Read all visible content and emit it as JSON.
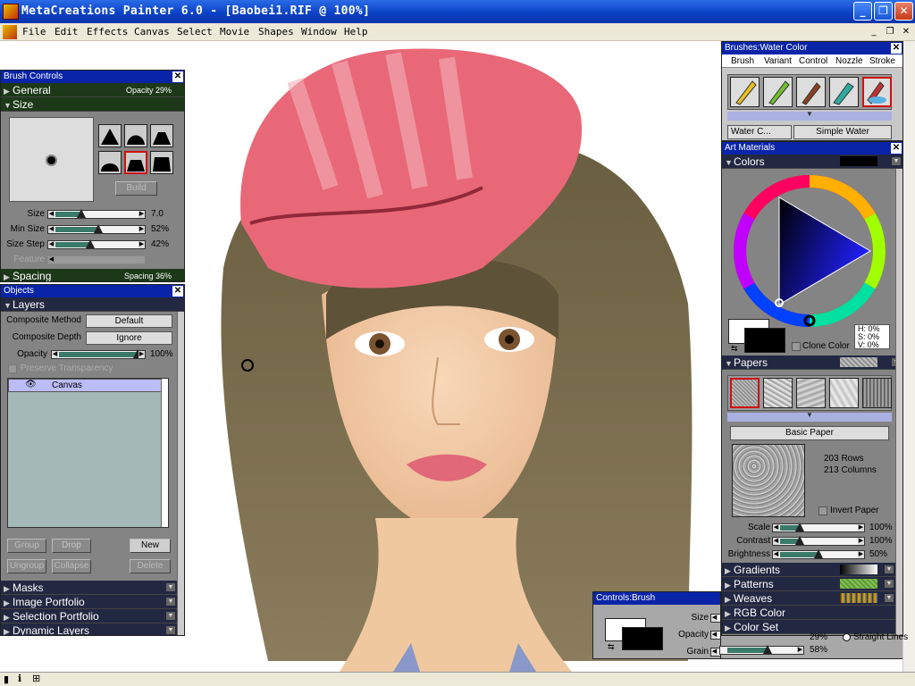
{
  "window": {
    "title": "MetaCreations Painter 6.0 - [Baobei1.RIF @ 100%]"
  },
  "menu": [
    "File",
    "Edit",
    "Effects",
    "Canvas",
    "Select",
    "Movie",
    "Shapes",
    "Window",
    "Help"
  ],
  "brush_controls": {
    "title": "Brush Controls",
    "general": {
      "label": "General",
      "info": "Opacity 29%"
    },
    "size": {
      "label": "Size",
      "build": "Build",
      "sliders": [
        {
          "label": "Size",
          "value": "7.0",
          "level": 0.31
        },
        {
          "label": "Min Size",
          "value": "52%",
          "level": 0.52
        },
        {
          "label": "Size Step",
          "value": "42%",
          "level": 0.42
        },
        {
          "label": "Feature",
          "value": "",
          "level": 0
        }
      ]
    },
    "spacing": {
      "label": "Spacing",
      "info": "Spacing 36%"
    }
  },
  "objects": {
    "title": "Objects",
    "layers": "Layers",
    "composite_method": {
      "label": "Composite Method",
      "value": "Default"
    },
    "composite_depth": {
      "label": "Composite Depth",
      "value": "Ignore"
    },
    "opacity": {
      "label": "Opacity",
      "value": "100%",
      "level": 1.0
    },
    "preserve": "Preserve Transparency",
    "layer_item": "Canvas",
    "buttons": {
      "group": "Group",
      "drop": "Drop",
      "new": "New",
      "ungroup": "Ungroup",
      "collapse": "Collapse",
      "delete": "Delete"
    },
    "sections": [
      "Masks",
      "Image Portfolio",
      "Selection Portfolio",
      "Dynamic Layers"
    ]
  },
  "brushes": {
    "title": "Brushes:Water Color",
    "menu": [
      "Brush",
      "Variant",
      "Control",
      "Nozzle",
      "Stroke"
    ],
    "category": "Water C...",
    "variant": "Simple Water"
  },
  "art_materials": {
    "title": "Art Materials",
    "colors": "Colors",
    "hsv": {
      "h": "H:  0%",
      "s": "S:  0%",
      "v": "V:  0%"
    },
    "clone_color": "Clone Color",
    "papers": "Papers",
    "paper_name": "Basic Paper",
    "rows": "203 Rows",
    "columns": "213 Columns",
    "invert": "Invert Paper",
    "paper_sliders": [
      {
        "label": "Scale",
        "value": "100%",
        "level": 0.25
      },
      {
        "label": "Contrast",
        "value": "100%",
        "level": 0.25
      },
      {
        "label": "Brightness",
        "value": "50%",
        "level": 0.5
      }
    ],
    "sections": [
      "Gradients",
      "Patterns",
      "Weaves",
      "RGB Color",
      "Color Set"
    ]
  },
  "controls_brush": {
    "title": "Controls:Brush",
    "sliders": [
      {
        "label": "Size",
        "value": "",
        "level": 0.0
      },
      {
        "label": "Opacity",
        "value": "29%",
        "level": 0.29
      },
      {
        "label": "Grain",
        "value": "58%",
        "level": 0.58
      }
    ],
    "straight_lines": "Straight Lines"
  },
  "colors": {
    "title_blue": "#0a24a8",
    "panel": "#848484",
    "section": "#1c3818"
  }
}
